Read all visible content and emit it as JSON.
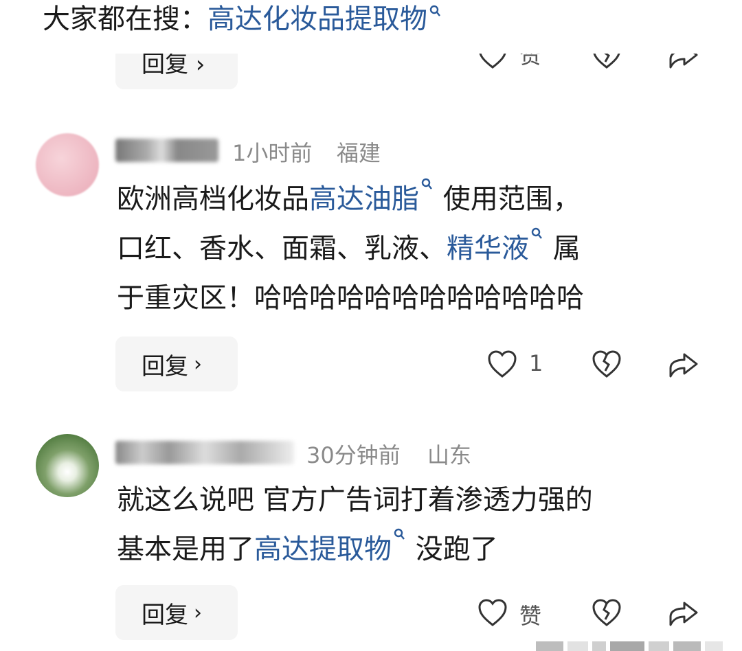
{
  "search_bar": {
    "prefix": "大家都在搜：",
    "query": "高达化妆品提取物"
  },
  "partial_row": {
    "reply_label": "回复 ›",
    "like_label": "赞"
  },
  "comments": [
    {
      "time": "1小时前",
      "location": "福建",
      "lines": [
        [
          "欧洲高档化妆品",
          "高达油脂",
          "使用范围，"
        ],
        [
          "口红、香水、面霜、乳液、",
          "精华液",
          "属"
        ],
        [
          "于重灾区！哈哈哈哈哈哈哈哈哈哈哈哈"
        ]
      ],
      "reply_label": "回复",
      "like_count": "1"
    },
    {
      "time": "30分钟前",
      "location": "山东",
      "lines": [
        [
          "就这么说吧 官方广告词打着渗透力强的"
        ],
        [
          "基本是用了",
          "高达提取物",
          "没跑了"
        ]
      ],
      "reply_label": "回复",
      "like_label": "赞"
    }
  ],
  "colors": {
    "link": "#2a5a9a",
    "reply_bg": "#f5f5f5",
    "meta_text": "#8a8a8a"
  },
  "icons": [
    "search-icon",
    "heart-icon",
    "broken-heart-icon",
    "share-icon",
    "chevron-right-icon"
  ]
}
